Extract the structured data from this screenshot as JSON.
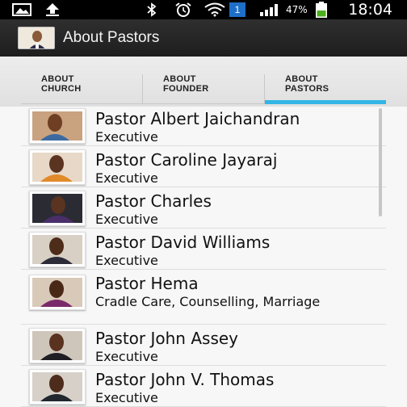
{
  "status_bar": {
    "battery_percent": "47%",
    "time": "18:04",
    "notification_badge": "1",
    "icons": [
      "image-icon",
      "download-icon",
      "bluetooth-icon",
      "alarm-icon",
      "wifi-icon",
      "signal-icon",
      "battery-icon"
    ]
  },
  "action_bar": {
    "title": "About Pastors",
    "icon": "app-logo-icon"
  },
  "tabs": [
    {
      "line1": "ABOUT",
      "line2": "CHURCH",
      "selected": false
    },
    {
      "line1": "ABOUT",
      "line2": "FOUNDER",
      "selected": false
    },
    {
      "line1": "ABOUT",
      "line2": "PASTORS",
      "selected": true
    }
  ],
  "accent_color": "#33b5e5",
  "pastors": [
    {
      "name": "Pastor Albert Jaichandran",
      "role": "Executive"
    },
    {
      "name": "Pastor Caroline Jayaraj",
      "role": "Executive"
    },
    {
      "name": "Pastor Charles",
      "role": "Executive"
    },
    {
      "name": "Pastor David Williams",
      "role": "Executive"
    },
    {
      "name": "Pastor Hema",
      "role": "Cradle Care, Counselling, Marriage"
    },
    {
      "name": "Pastor John Assey",
      "role": "Executive"
    },
    {
      "name": "Pastor John V. Thomas",
      "role": "Executive"
    }
  ]
}
